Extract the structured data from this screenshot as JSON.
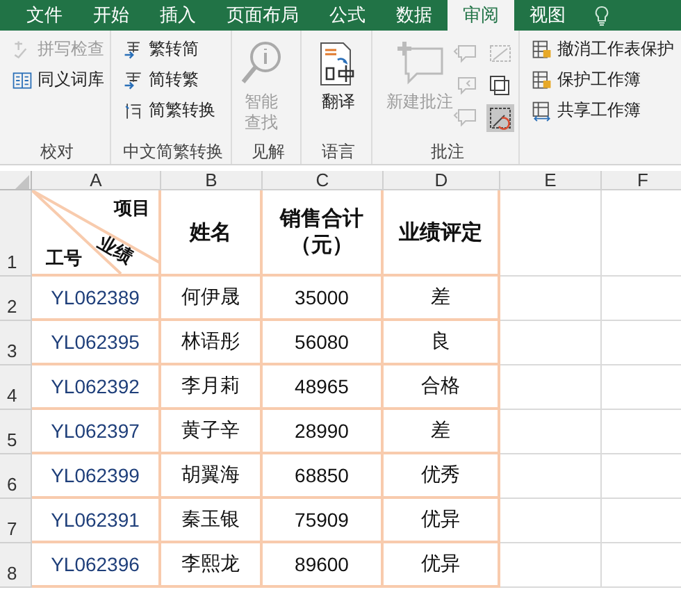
{
  "tabs": [
    {
      "label": "文件",
      "selected": false
    },
    {
      "label": "开始",
      "selected": false
    },
    {
      "label": "插入",
      "selected": false
    },
    {
      "label": "页面布局",
      "selected": false
    },
    {
      "label": "公式",
      "selected": false
    },
    {
      "label": "数据",
      "selected": false
    },
    {
      "label": "审阅",
      "selected": true
    },
    {
      "label": "视图",
      "selected": false
    }
  ],
  "ribbon": {
    "groups": [
      {
        "label": "校对",
        "items": [
          {
            "kind": "small",
            "label": "拼写检查",
            "disabled": true
          },
          {
            "kind": "small",
            "label": "同义词库",
            "disabled": false
          }
        ]
      },
      {
        "label": "中文简繁转换",
        "items": [
          {
            "kind": "small",
            "label": "繁转简",
            "disabled": false
          },
          {
            "kind": "small",
            "label": "简转繁",
            "disabled": false
          },
          {
            "kind": "small",
            "label": "简繁转换",
            "disabled": false
          }
        ]
      },
      {
        "label": "见解",
        "items": [
          {
            "kind": "large",
            "label": "智能查找",
            "disabled": true
          }
        ]
      },
      {
        "label": "语言",
        "items": [
          {
            "kind": "large",
            "label": "翻译",
            "disabled": false
          }
        ]
      },
      {
        "label": "批注",
        "items": [
          {
            "kind": "large",
            "label": "新建批注",
            "disabled": true
          },
          {
            "kind": "icon",
            "disabled": true,
            "selected": false
          },
          {
            "kind": "icon",
            "disabled": true,
            "selected": false
          },
          {
            "kind": "icon",
            "disabled": true,
            "selected": false
          },
          {
            "kind": "icon",
            "disabled": true,
            "selected": false
          },
          {
            "kind": "icon",
            "disabled": false,
            "selected": false
          },
          {
            "kind": "icon",
            "disabled": false,
            "selected": true
          }
        ]
      },
      {
        "items": [
          {
            "kind": "small",
            "label": "撤消工作表保护",
            "disabled": false
          },
          {
            "kind": "small",
            "label": "保护工作簿",
            "disabled": false
          },
          {
            "kind": "small",
            "label": "共享工作簿",
            "disabled": false
          }
        ]
      }
    ]
  },
  "sheet": {
    "columns": [
      "A",
      "B",
      "C",
      "D",
      "E",
      "F"
    ],
    "header": {
      "diagonal": {
        "top": "项目",
        "middle": "业绩",
        "bottom": "工号"
      },
      "cells": [
        "姓名",
        "销售合计（元）",
        "业绩评定"
      ]
    },
    "rows": [
      {
        "number": "1"
      },
      {
        "number": "2",
        "cells": [
          "YL062389",
          "何伊晟",
          "35000",
          "差"
        ]
      },
      {
        "number": "3",
        "cells": [
          "YL062395",
          "林语彤",
          "56080",
          "良"
        ]
      },
      {
        "number": "4",
        "cells": [
          "YL062392",
          "李月莉",
          "48965",
          "合格"
        ]
      },
      {
        "number": "5",
        "cells": [
          "YL062397",
          "黄子辛",
          "28990",
          "差"
        ]
      },
      {
        "number": "6",
        "cells": [
          "YL062399",
          "胡翼海",
          "68850",
          "优秀"
        ]
      },
      {
        "number": "7",
        "cells": [
          "YL062391",
          "秦玉银",
          "75909",
          "优异"
        ]
      },
      {
        "number": "8",
        "cells": [
          "YL062396",
          "李熙龙",
          "89600",
          "优异"
        ]
      }
    ]
  }
}
